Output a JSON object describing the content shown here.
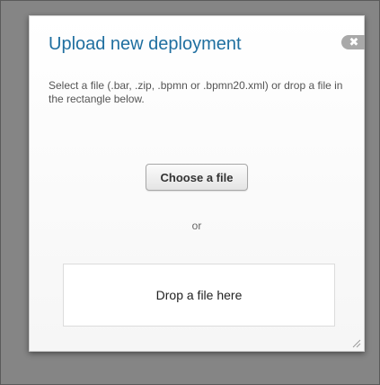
{
  "dialog": {
    "title": "Upload new deployment",
    "close_icon": "close-icon",
    "close_glyph": "✖",
    "description": "Select a file (.bar, .zip, .bpmn or .bpmn20.xml) or drop a file in the rectangle below.",
    "choose_button_label": "Choose a file",
    "or_text": "or",
    "drop_zone_label": "Drop a file here",
    "resize_icon": "resize-grip-icon"
  },
  "colors": {
    "title": "#1f6fa0",
    "overlay": "#858585",
    "close_button": "#a9a9a9"
  }
}
